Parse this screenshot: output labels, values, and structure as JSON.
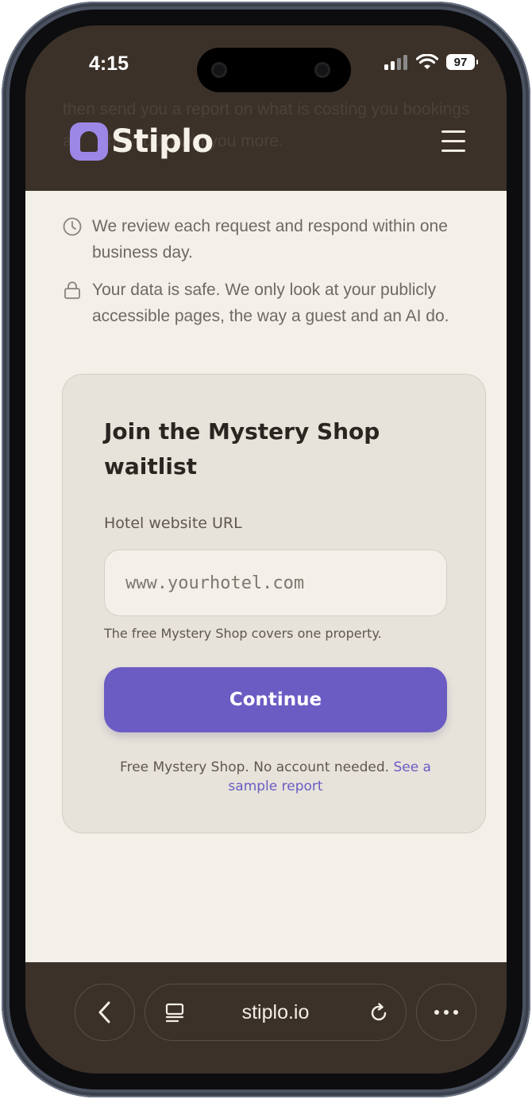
{
  "status_bar": {
    "time": "4:15",
    "battery": "97"
  },
  "header": {
    "overlay_text": "then send you a report on what is costing you bookings and what could win you more.",
    "logo_text": "Stiplo"
  },
  "notes": [
    {
      "icon": "clock-icon",
      "text": "We review each request and respond within one business day."
    },
    {
      "icon": "lock-icon",
      "text": "Your data is safe. We only look at your publicly accessible pages, the way a guest and an AI do."
    }
  ],
  "form": {
    "title": "Join the Mystery Shop waitlist",
    "url_label": "Hotel website URL",
    "url_placeholder": "www.yourhotel.com",
    "url_value": "",
    "helper": "The free Mystery Shop covers one property.",
    "submit_label": "Continue",
    "footnote_text": "Free Mystery Shop. No account needed.",
    "footnote_link": "See a sample report"
  },
  "browser": {
    "url": "stiplo.io"
  },
  "colors": {
    "accent": "#6b5cc4",
    "header_bg": "#3b3129",
    "page_bg": "#f3f0e9",
    "card_bg": "#e7e3da",
    "logo_mark": "#9c87e6"
  }
}
